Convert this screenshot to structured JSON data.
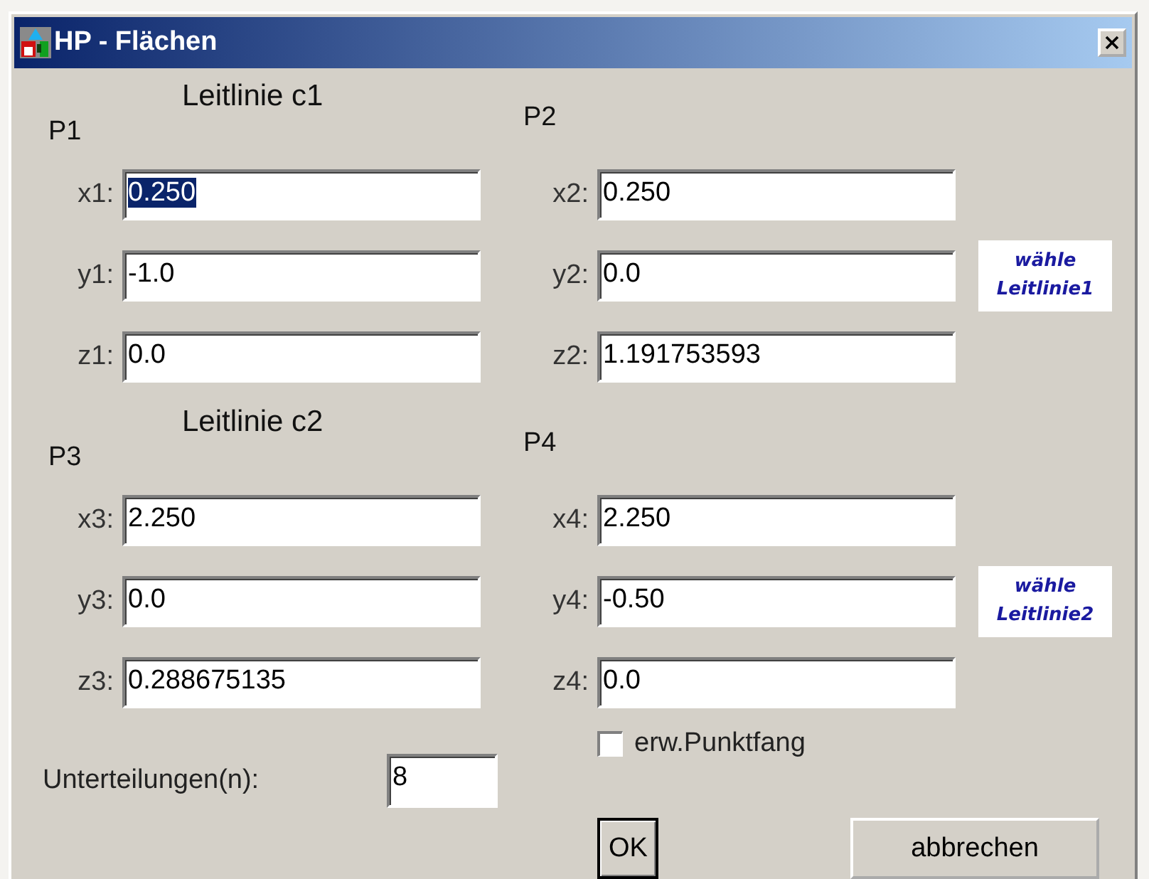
{
  "window": {
    "title": "HP - Flächen"
  },
  "groups": [
    {
      "heading": "Leitlinie c1",
      "pick_button": "wähle\nLeitlinie1",
      "points": [
        {
          "label": "P1",
          "fields": [
            {
              "label": "x1:",
              "value": "0.250",
              "text_selected": true
            },
            {
              "label": "y1:",
              "value": "-1.0",
              "text_selected": false
            },
            {
              "label": "z1:",
              "value": "0.0",
              "text_selected": false
            }
          ]
        },
        {
          "label": "P2",
          "fields": [
            {
              "label": "x2:",
              "value": "0.250",
              "text_selected": false
            },
            {
              "label": "y2:",
              "value": "0.0",
              "text_selected": false
            },
            {
              "label": "z2:",
              "value": "1.191753593",
              "text_selected": false
            }
          ]
        }
      ]
    },
    {
      "heading": "Leitlinie c2",
      "pick_button": "wähle\nLeitlinie2",
      "points": [
        {
          "label": "P3",
          "fields": [
            {
              "label": "x3:",
              "value": "2.250",
              "text_selected": false
            },
            {
              "label": "y3:",
              "value": "0.0",
              "text_selected": false
            },
            {
              "label": "z3:",
              "value": "0.288675135",
              "text_selected": false
            }
          ]
        },
        {
          "label": "P4",
          "fields": [
            {
              "label": "x4:",
              "value": "2.250",
              "text_selected": false
            },
            {
              "label": "y4:",
              "value": "-0.50",
              "text_selected": false
            },
            {
              "label": "z4:",
              "value": "0.0",
              "text_selected": false
            }
          ]
        }
      ]
    }
  ],
  "subdivisions": {
    "label": "Unterteilungen(n):",
    "value": "8"
  },
  "snap": {
    "label": "erw.Punktfang",
    "checked": false
  },
  "buttons": [
    {
      "label": "OK",
      "default": true
    },
    {
      "label": "abbrechen",
      "default": false
    }
  ]
}
